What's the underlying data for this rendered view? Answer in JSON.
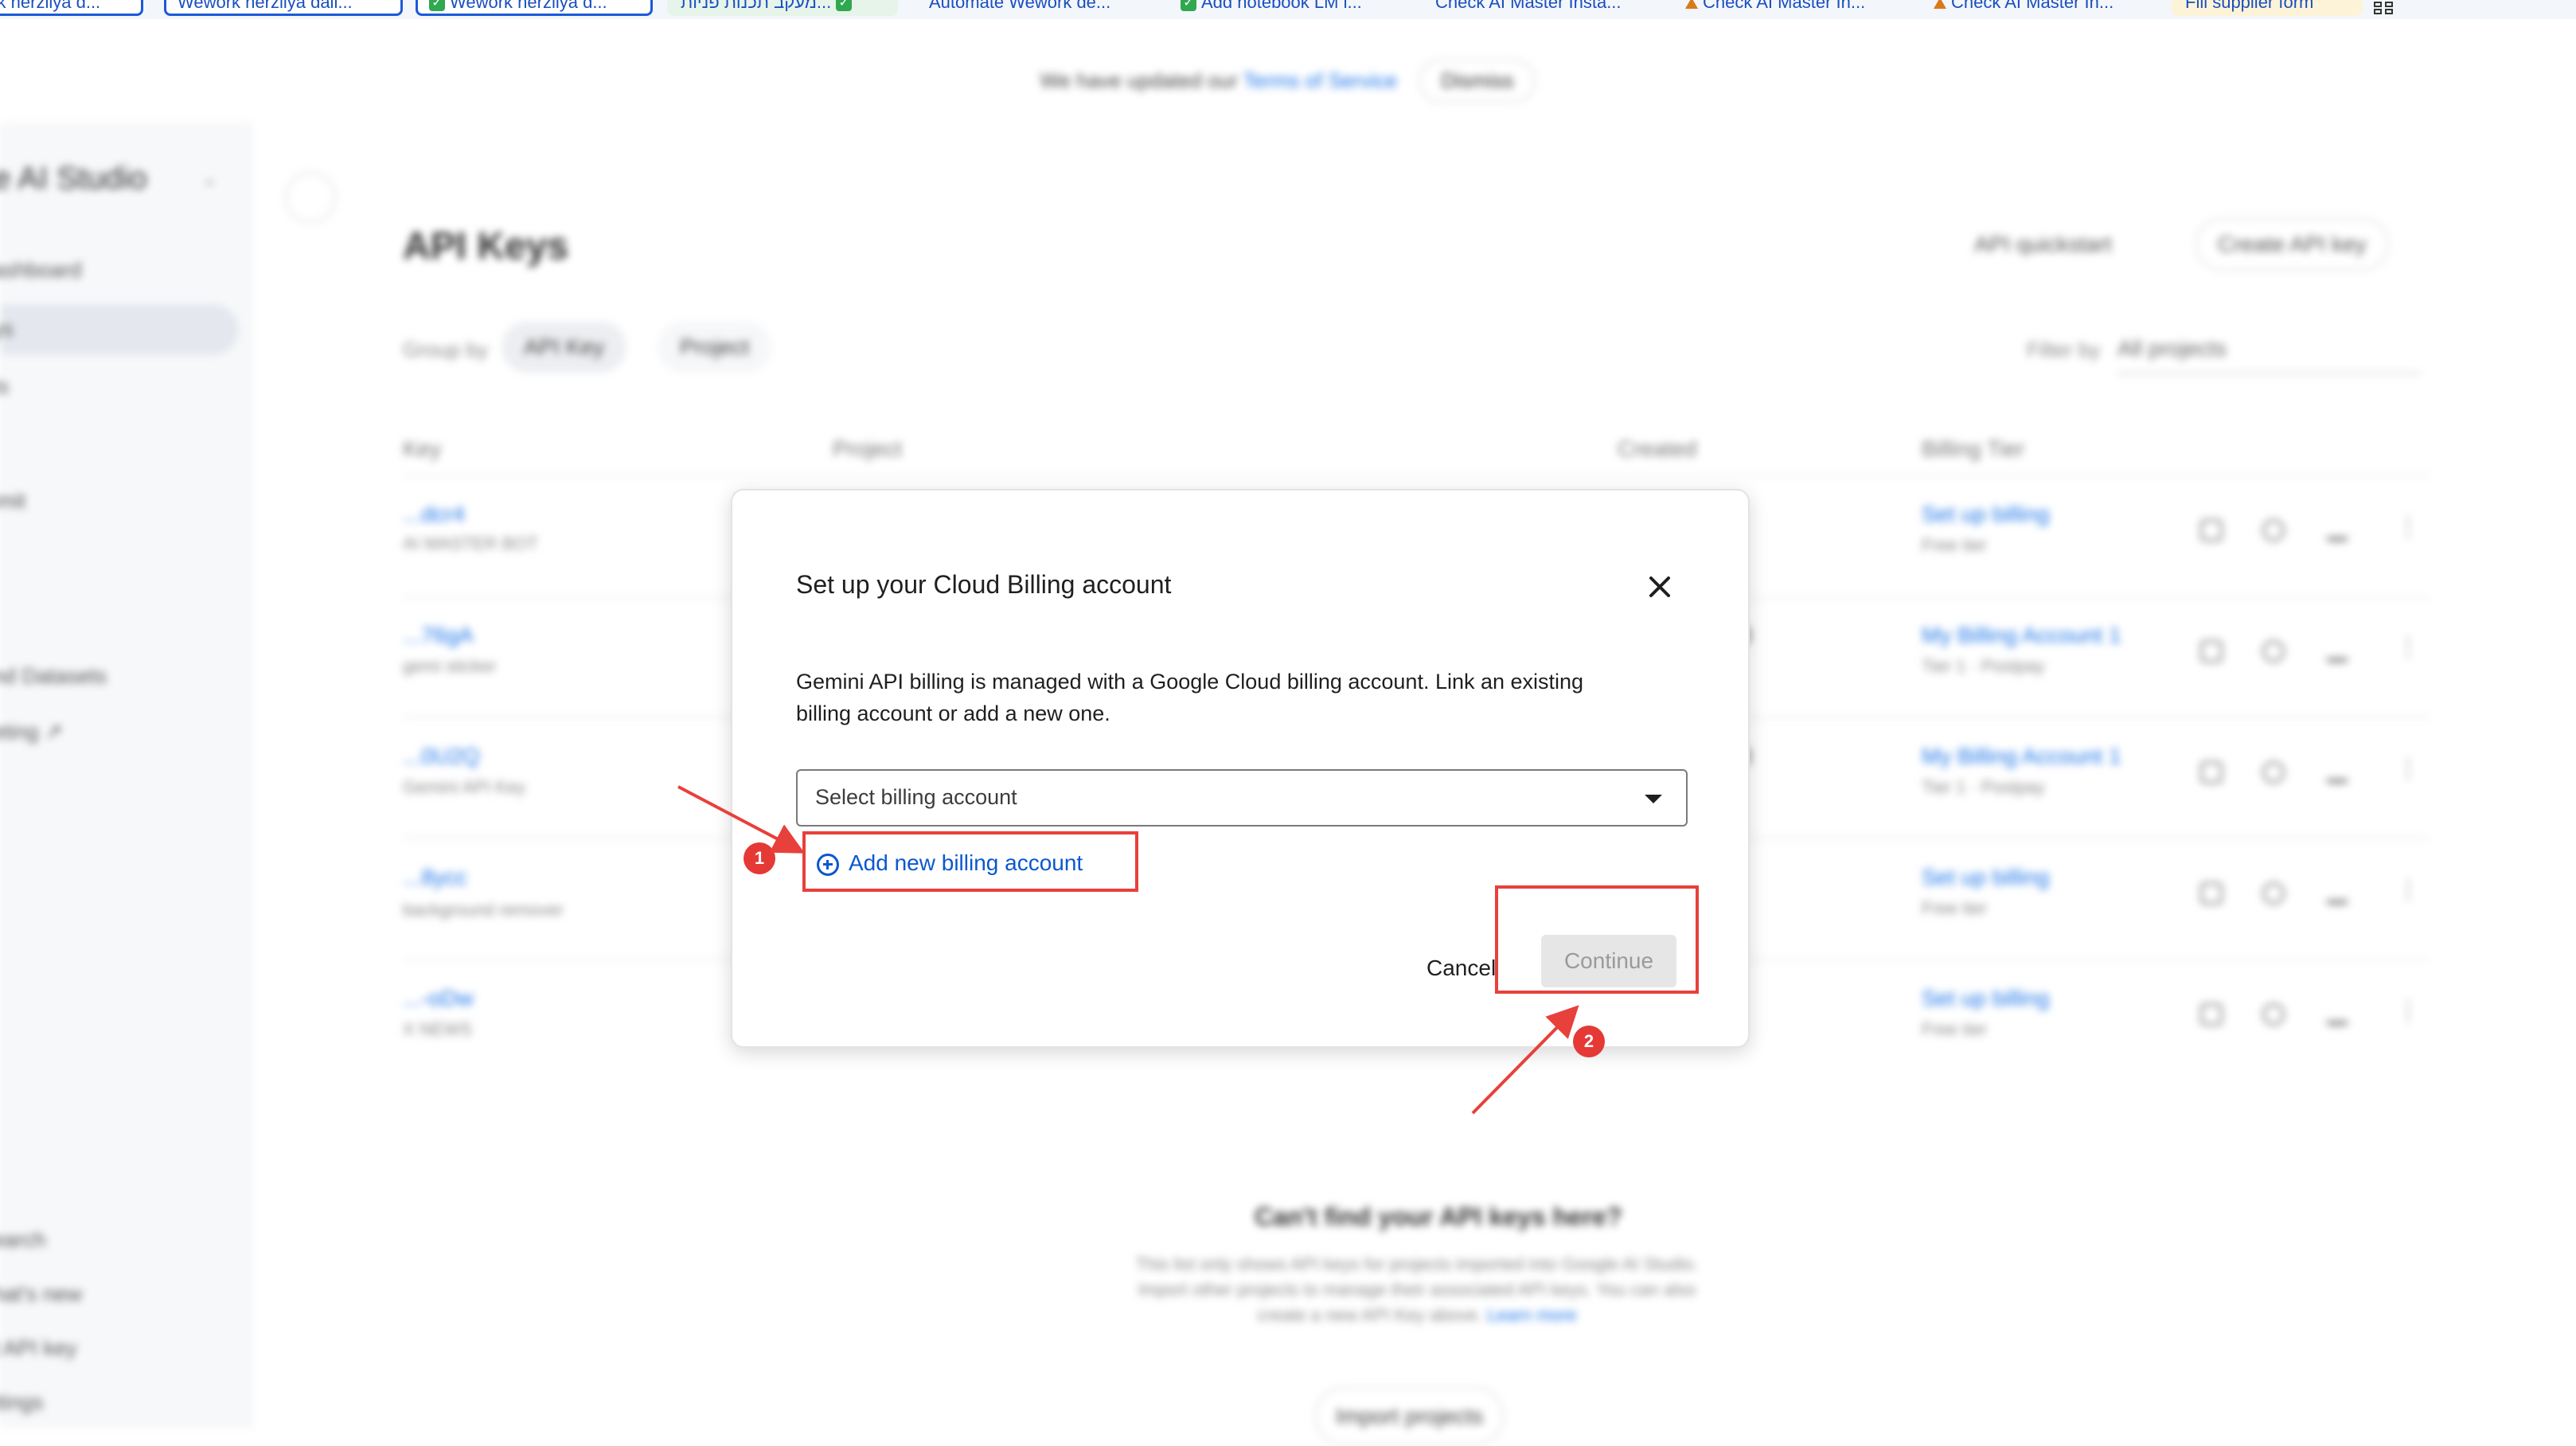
{
  "bookmarks": [
    {
      "label": "ork herzliya d...",
      "style": "boxed"
    },
    {
      "label": "Wework herzliya dail...",
      "style": "boxed"
    },
    {
      "label": "Wework herzliya d...",
      "style": "boxed-check"
    },
    {
      "label": "מעקב תכנות פניות...",
      "style": "check"
    },
    {
      "label": "Automate Wework de...",
      "style": "plain"
    },
    {
      "label": "Add notebook LM i...",
      "style": "check"
    },
    {
      "label": "Check AI Master Insta...",
      "style": "plain"
    },
    {
      "label": "Check AI Master In...",
      "style": "tri"
    },
    {
      "label": "Check AI Master In...",
      "style": "tri"
    },
    {
      "label": "Fill supplier form",
      "style": "plain"
    }
  ],
  "tos_bar": {
    "prefix": "We have updated our",
    "link": "Terms of Service",
    "dismiss": "Dismiss"
  },
  "sidebar": {
    "brand": "gle AI Studio",
    "items": [
      "ashboard",
      "ys",
      "ts",
      "",
      "imit",
      "",
      "nd Datasets",
      "eting ↗"
    ],
    "bottom_items": [
      "earch",
      "hat's new",
      "t API key",
      "ttings"
    ]
  },
  "page": {
    "title": "API Keys",
    "quickstart": "API quickstart",
    "create_key": "Create API key",
    "group_by_label": "Group by",
    "chips": [
      "API Key",
      "Project"
    ],
    "filter_by_label": "Filter by",
    "filter_value": "All projects"
  },
  "table": {
    "columns": [
      "Key",
      "Project",
      "Created",
      "Billing Tier"
    ],
    "rows": [
      {
        "key": "...dcr4",
        "name": "AI MASTER BOT",
        "billing": "Set up billing",
        "tier": "Free tier",
        "date": ""
      },
      {
        "key": "...76gA",
        "name": "gemi sticker",
        "billing": "My Billing Account 1",
        "tier": "Tier 1 · Postpay",
        "date": "3"
      },
      {
        "key": "...0U2Q",
        "name": "Gemini API Key",
        "billing": "My Billing Account 1",
        "tier": "Tier 1 · Postpay",
        "date": "3"
      },
      {
        "key": "...8ycc",
        "name": "background remover",
        "billing": "Set up billing",
        "tier": "Free tier",
        "date": ""
      },
      {
        "key": "...-oDw",
        "name": "X NEWS",
        "billing": "Set up billing",
        "tier": "Free tier",
        "date": ""
      }
    ]
  },
  "empty_help": {
    "title": "Can't find your API keys here?",
    "body": "This list only shows API keys for projects imported into Google AI Studio. Import other projects to manage their associated API keys. You can also create a new API Key above.",
    "learn_more": "Learn more",
    "import": "Import projects"
  },
  "modal": {
    "title": "Set up your Cloud Billing account",
    "description": "Gemini API billing is managed with a Google Cloud billing account. Link an existing billing account or add a new one.",
    "select_placeholder": "Select billing account",
    "add_new": "Add new billing account",
    "cancel": "Cancel",
    "continue": "Continue"
  },
  "annotations": {
    "badge1": "1",
    "badge2": "2",
    "color": "#e8403b"
  }
}
